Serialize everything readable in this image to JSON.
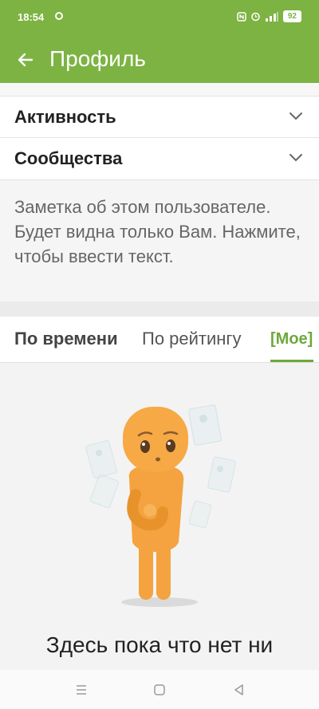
{
  "status_bar": {
    "time": "18:54",
    "battery": "92",
    "icons": [
      "sync-icon",
      "nfc-icon",
      "alarm-icon",
      "signal-icon"
    ]
  },
  "app_bar": {
    "title": "Профиль",
    "back_icon": "arrow-left-icon"
  },
  "sections": [
    {
      "label": "Активность",
      "icon": "chevron-down-icon"
    },
    {
      "label": "Сообщества",
      "icon": "chevron-down-icon"
    }
  ],
  "note": {
    "placeholder": "Заметка об этом пользователе. Будет видна только Вам. Нажмите, чтобы ввести текст."
  },
  "tabs": [
    {
      "label": "По времени",
      "selected": false
    },
    {
      "label": "По рейтингу",
      "selected": false
    },
    {
      "label": "[Мое]",
      "selected": true
    }
  ],
  "empty_state": {
    "illustration": "thinking-character",
    "message": "Здесь пока что нет ни"
  },
  "nav_bar": {
    "icons": [
      "menu-icon",
      "home-square-icon",
      "back-triangle-icon"
    ]
  },
  "colors": {
    "primary": "#7cb342",
    "accent_tab": "#6ea83c"
  }
}
